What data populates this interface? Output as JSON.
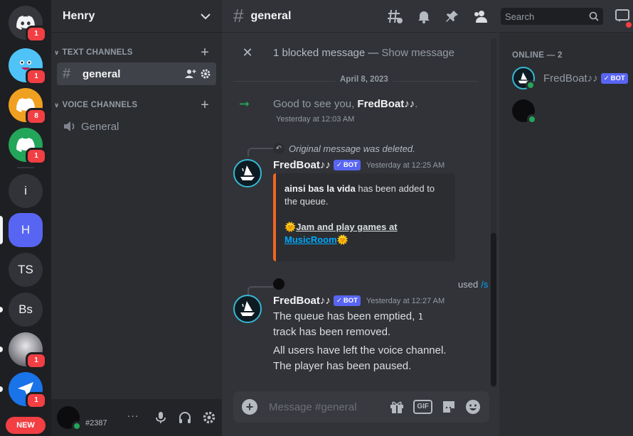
{
  "rail": {
    "servers": [
      {
        "kind": "discord",
        "color": "#36373d",
        "badge": "1"
      },
      {
        "kind": "face",
        "color": "#4fc3f7",
        "badge": "1"
      },
      {
        "kind": "discord",
        "color": "#f0a020",
        "badge": "8"
      },
      {
        "kind": "discord",
        "color": "#23a55a",
        "badge": "1"
      }
    ],
    "initials": [
      "i",
      "H",
      "TS",
      "Bs"
    ],
    "bottom_badges": [
      "1",
      "1"
    ],
    "new_label": "NEW"
  },
  "guild": {
    "name": "Henry",
    "text_category": "TEXT CHANNELS",
    "voice_category": "VOICE CHANNELS",
    "text_channel": "general",
    "voice_channel": "General"
  },
  "user": {
    "tag": "#2387",
    "dots": "···"
  },
  "topbar": {
    "channel": "general",
    "search_placeholder": "Search"
  },
  "messages": {
    "blocked": {
      "text": "1 blocked message —",
      "action": "Show message"
    },
    "date": "April 8, 2023",
    "join": {
      "prefix": "Good to see you,",
      "name": "FredBoat♪♪",
      "suffix": ".",
      "time": "Yesterday at 12:03 AM"
    },
    "reply1": {
      "text": "Original message was deleted."
    },
    "msg1": {
      "author": "FredBoat♪♪",
      "badge": "BOT",
      "time": "Yesterday at 12:25 AM",
      "embed_bold": "ainsi bas la vida",
      "embed_line1_rest": "has been added to",
      "embed_line2": "the queue.",
      "embed_link1": "Jam and play games at",
      "embed_link2": "MusicRoom"
    },
    "used": {
      "text": "used",
      "cmd": "/s"
    },
    "msg2": {
      "author": "FredBoat♪♪",
      "badge": "BOT",
      "time": "Yesterday at 12:27 AM",
      "line1a": "The queue has been emptied,",
      "line1b": "1",
      "line2": "track has been removed.",
      "line3": "All users have left the voice channel.",
      "line4": "The player has been paused."
    }
  },
  "composer": {
    "placeholder": "Message #general",
    "gif": "GIF"
  },
  "members": {
    "header": "ONLINE — 2",
    "list": [
      {
        "name": "FredBoat♪♪",
        "badge": "BOT"
      }
    ]
  },
  "colors": {
    "accent": "#5865f2",
    "online": "#23a55a",
    "alert": "#f23f43",
    "embed_bar": "#f26522",
    "link": "#00a8fc"
  }
}
